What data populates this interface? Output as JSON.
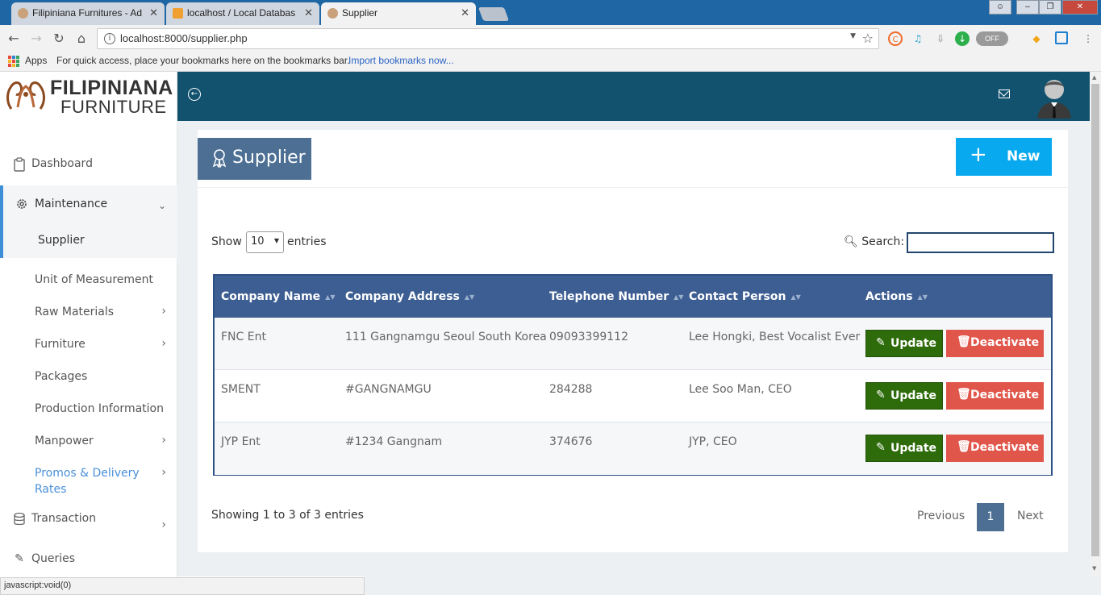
{
  "browser": {
    "tabs": [
      {
        "title": "Filipiniana Furnitures - Ad",
        "active": false
      },
      {
        "title": "localhost / Local Databas",
        "active": false
      },
      {
        "title": "Supplier",
        "active": true
      }
    ],
    "url": "localhost:8000/supplier.php",
    "ext_off_label": "OFF",
    "bookmarks": {
      "apps_label": "Apps",
      "hint": "For quick access, place your bookmarks here on the bookmarks bar.",
      "import_link": "Import bookmarks now..."
    },
    "status_text": "javascript:void(0)"
  },
  "brand": {
    "line1": "FILIPINIANA",
    "line2": "FURNITURE"
  },
  "sidebar": {
    "items": [
      {
        "label": "Dashboard",
        "icon": "clipboard-icon"
      },
      {
        "label": "Maintenance",
        "icon": "gear-icon"
      },
      {
        "label": "Transaction",
        "icon": "database-icon"
      },
      {
        "label": "Queries",
        "icon": "pencil-icon"
      }
    ],
    "sub_items": [
      {
        "label": "Supplier",
        "active": true
      },
      {
        "label": "Unit of Measurement"
      },
      {
        "label": "Raw Materials"
      },
      {
        "label": "Furniture"
      },
      {
        "label": "Packages"
      },
      {
        "label": "Production Information"
      },
      {
        "label": "Manpower"
      },
      {
        "label": "Promos & Delivery",
        "label2": "Rates",
        "highlight": true
      }
    ]
  },
  "page": {
    "title": "Supplier",
    "new_button": "New",
    "show_label": "Show",
    "entries_value": "10",
    "entries_label": "entries",
    "search_label": "Search:",
    "search_value": ""
  },
  "table": {
    "columns": [
      "Company Name",
      "Company Address",
      "Telephone Number",
      "Contact Person",
      "Actions"
    ],
    "rows": [
      {
        "company": "FNC Ent",
        "address": "111 Gangnamgu Seoul South Korea",
        "phone": "09093399112",
        "contact": "Lee Hongki, Best Vocalist Ever"
      },
      {
        "company": "SMENT",
        "address": "#GANGNAMGU",
        "phone": "284288",
        "contact": "Lee Soo Man, CEO"
      },
      {
        "company": "JYP Ent",
        "address": "#1234 Gangnam",
        "phone": "374676",
        "contact": "JYP, CEO"
      }
    ],
    "update_label": "Update",
    "deactivate_label": "Deactivate"
  },
  "footer": {
    "showing": "Showing 1 to 3 of 3 entries",
    "previous": "Previous",
    "page": "1",
    "next": "Next"
  },
  "colors": {
    "topbar": "#12526e",
    "title_box": "#4d6f94",
    "new_button": "#08a9ee",
    "update": "#2e6b0a",
    "deactivate": "#e0564b",
    "table_header": "#3d5e92"
  }
}
